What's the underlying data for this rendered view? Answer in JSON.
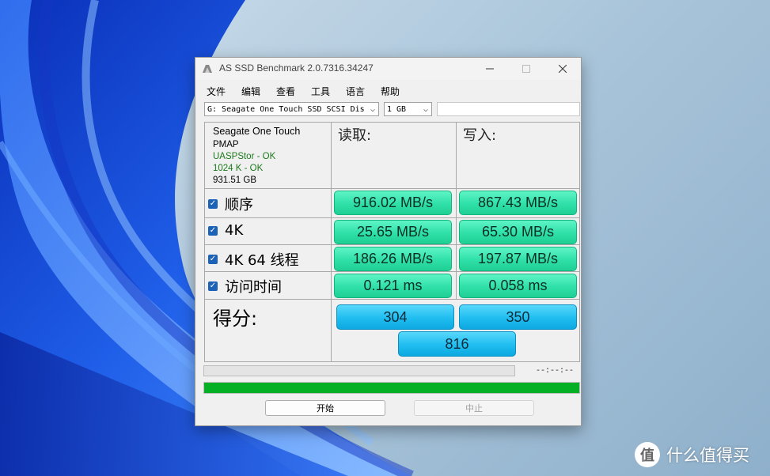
{
  "window": {
    "title": "AS SSD Benchmark 2.0.7316.34247"
  },
  "menu": [
    "文件",
    "编辑",
    "查看",
    "工具",
    "语言",
    "帮助"
  ],
  "drive_select": "G: Seagate One Touch SSD SCSI Dis",
  "size_select": "1 GB",
  "drive_info": {
    "name": "Seagate One Touch",
    "driver": "PMAP",
    "uasp": "UASPStor - OK",
    "alignment": "1024 K - OK",
    "capacity": "931.51 GB"
  },
  "columns": {
    "read": "读取:",
    "write": "写入:"
  },
  "rows": [
    {
      "label": "顺序",
      "checked": true,
      "read": "916.02 MB/s",
      "write": "867.43 MB/s"
    },
    {
      "label": "4K",
      "checked": true,
      "read": "25.65 MB/s",
      "write": "65.30 MB/s"
    },
    {
      "label": "4K 64 线程",
      "checked": true,
      "read": "186.26 MB/s",
      "write": "197.87 MB/s"
    },
    {
      "label": "访问时间",
      "checked": true,
      "read": "0.121 ms",
      "write": "0.058 ms"
    }
  ],
  "score": {
    "label": "得分:",
    "read": "304",
    "write": "350",
    "total": "816"
  },
  "status": {
    "time": "--:--:--",
    "progress_fraction": 1.0,
    "progress_color": "#06b025"
  },
  "buttons": {
    "start": "开始",
    "abort": "中止"
  },
  "watermark": {
    "text": "什么值得买",
    "icon_char": "值"
  },
  "colors": {
    "value_box": "#2fe0a8",
    "score_box": "#1fbdf0",
    "checkbox": "#1c63b7"
  }
}
